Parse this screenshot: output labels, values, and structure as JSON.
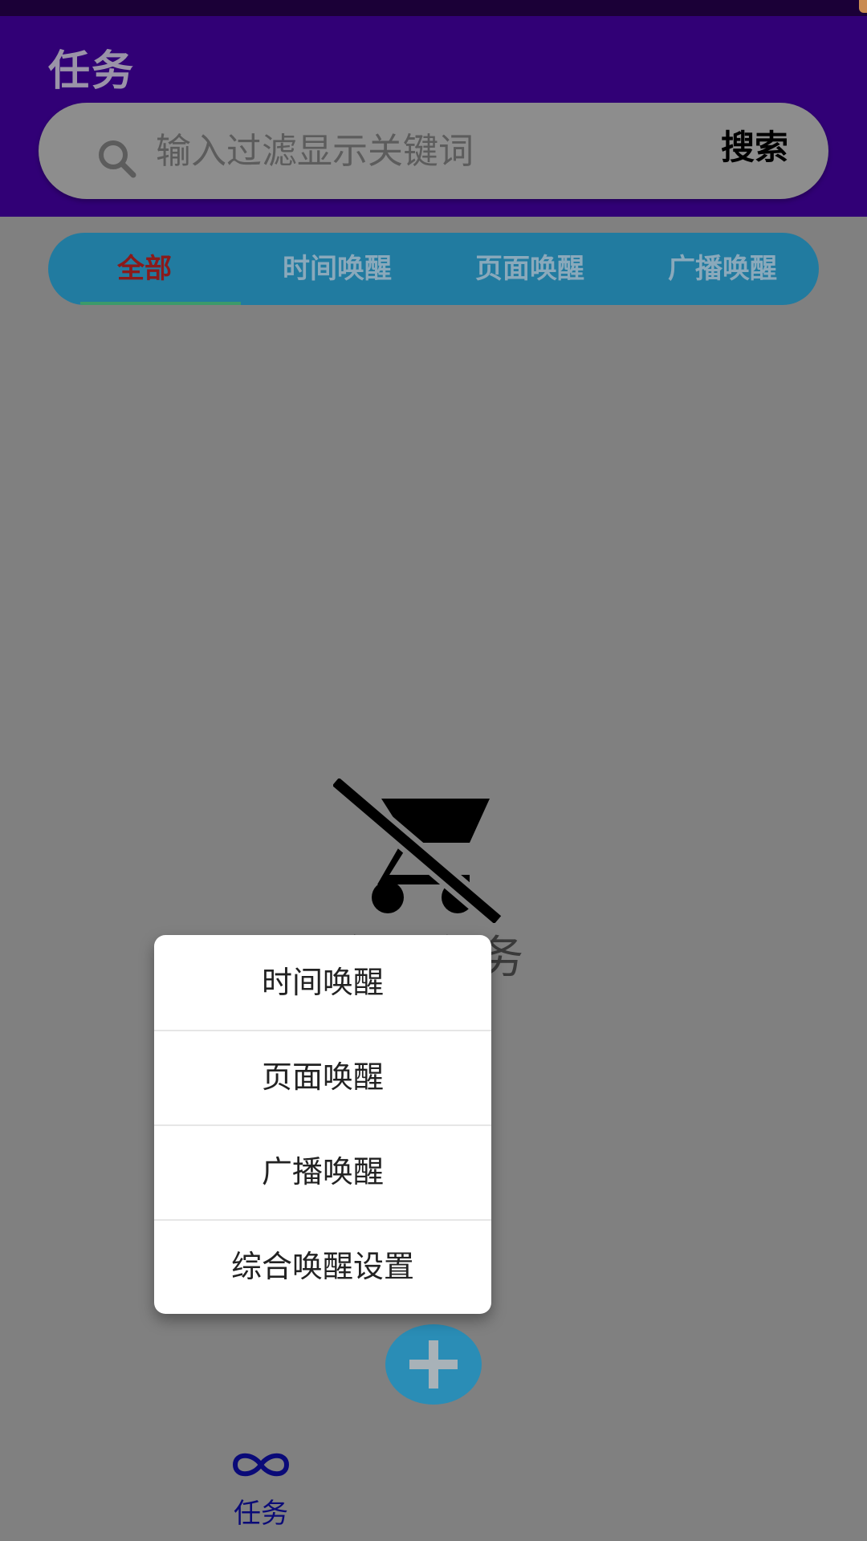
{
  "header": {
    "title": "任务"
  },
  "search": {
    "placeholder": "输入过滤显示关键词",
    "value": "",
    "button_label": "搜索",
    "icon": "search-icon"
  },
  "tabs": [
    {
      "label": "全部",
      "active": true
    },
    {
      "label": "时间唤醒",
      "active": false
    },
    {
      "label": "页面唤醒",
      "active": false
    },
    {
      "label": "广播唤醒",
      "active": false
    }
  ],
  "empty_state": {
    "icon": "remove-shopping-cart-icon",
    "text": "暂无任务"
  },
  "popup_menu": {
    "items": [
      {
        "label": "时间唤醒"
      },
      {
        "label": "页面唤醒"
      },
      {
        "label": "广播唤醒"
      },
      {
        "label": "综合唤醒设置"
      }
    ]
  },
  "fab": {
    "icon": "plus-icon"
  },
  "bottom_nav": {
    "items": [
      {
        "label": "任务",
        "icon": "infinity-icon"
      }
    ]
  },
  "colors": {
    "app_bar": "#310076",
    "tab_bar": "#217ba0",
    "active_tab_text": "#8b1a1a",
    "fab": "#2a8db6",
    "nav_active": "#0a0a78"
  }
}
